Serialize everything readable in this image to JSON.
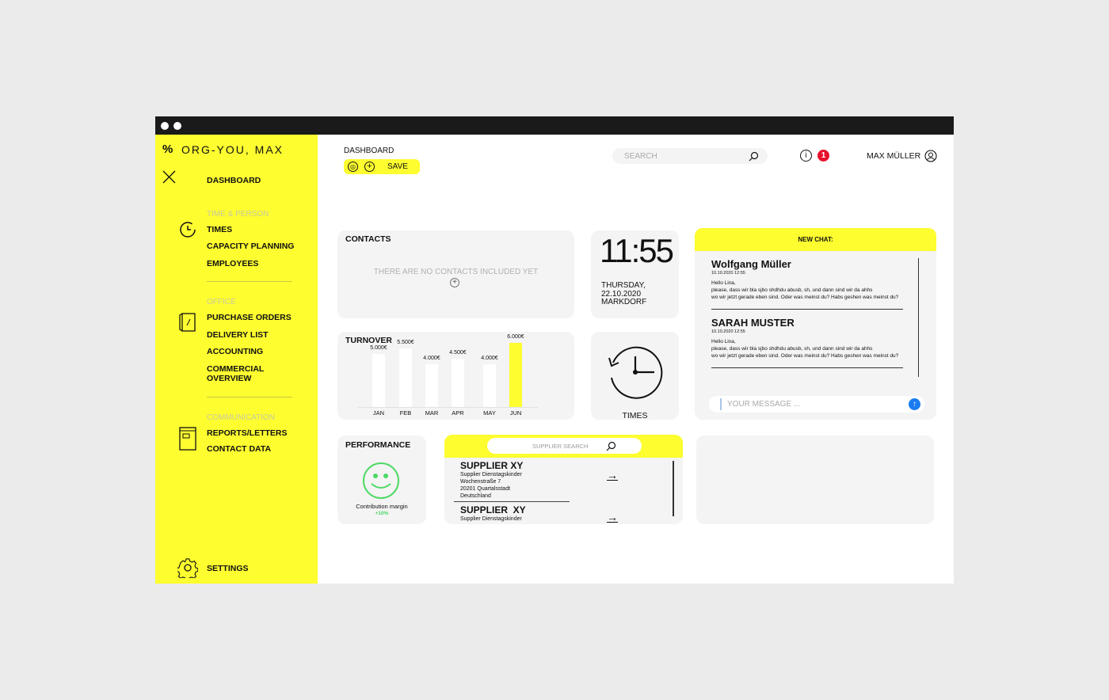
{
  "app": {
    "title": "ORG-YOU, MAX"
  },
  "sidebar": {
    "dashboard": "DASHBOARD",
    "sections": [
      {
        "label": "TIME & PERSON",
        "items": [
          "TIMES",
          "CAPACITY PLANNING",
          "EMPLOYEES"
        ]
      },
      {
        "label": "OFFICE",
        "items": [
          "PURCHASE ORDERS",
          "DELIVERY LIST",
          "ACCOUNTING",
          "COMMERCIAL OVERVIEW"
        ]
      },
      {
        "label": "COMMUNICATION",
        "items": [
          "REPORTS/LETTERS",
          "CONTACT DATA"
        ]
      }
    ],
    "settings": "SETTINGS"
  },
  "header": {
    "breadcrumb": "DASHBOARD",
    "save_label": "SAVE",
    "search_placeholder": "SEARCH",
    "notification_count": "1",
    "user_name": "MAX MÜLLER"
  },
  "contacts": {
    "title": "CONTACTS",
    "empty": "THERE ARE NO CONTACTS INCLUDED YET"
  },
  "clock": {
    "time": "11:55",
    "day": "THURSDAY,",
    "date": "22.10.2020",
    "place": "MARKDORF"
  },
  "times": {
    "label": "TIMES"
  },
  "chart_data": {
    "type": "bar",
    "title": "TURNOVER",
    "categories": [
      "JAN",
      "FEB",
      "MAR",
      "APR",
      "MAY",
      "JUN"
    ],
    "values": [
      5000,
      5500,
      4000,
      4500,
      4000,
      6000
    ],
    "labels": [
      "5.000€",
      "5.500€",
      "4.000€",
      "4.500€",
      "4.000€",
      "6.000€"
    ],
    "highlight": "JUN",
    "colors": {
      "bar": "#ffffff",
      "highlight": "#fdfd30"
    }
  },
  "performance": {
    "title": "PERFORMANCE",
    "label": "Contribution margin",
    "value": "+10%",
    "color": "#4cd964"
  },
  "suppliers": {
    "search_placeholder": "SUPPLIER SEARCH",
    "items": [
      {
        "name": "SUPPLIER XY",
        "lines": [
          "Supplier Dienstagskinder",
          "Wochenstraße 7",
          "20201 Quartalsstadt",
          "Deutschland"
        ]
      },
      {
        "name": "SUPPLIER  XY",
        "lines": [
          "Supplier Dienstagskinder"
        ]
      }
    ]
  },
  "chat": {
    "title": "NEW CHAT:",
    "messages": [
      {
        "author": "Wolfgang Müller",
        "time": "10.10.2020 12:55",
        "greeting": "Hello Lina,",
        "line1": "please, dass wir bla sjbo shdhdu  abusb, sh, und dann sind wir da ahhs",
        "line2": "wo wir jetzt gerade eben sind. Oder was meinst du? Habs geshen was meinst du?"
      },
      {
        "author": "SARAH MUSTER",
        "time": "10.10.2020 12:55",
        "greeting": "Hello Lina,",
        "line1": "please, dass wir bla sjbo shdhdu  abusb, sh, und dann sind wir da ahhs",
        "line2": "wo wir jetzt gerade eben sind. Oder was meinst du? Habs geshen was meinst du?"
      }
    ],
    "input_placeholder": "YOUR MESSAGE ..."
  },
  "colors": {
    "accent": "#fdfd30",
    "badge": "#e8112d",
    "send": "#1a7cf0"
  }
}
